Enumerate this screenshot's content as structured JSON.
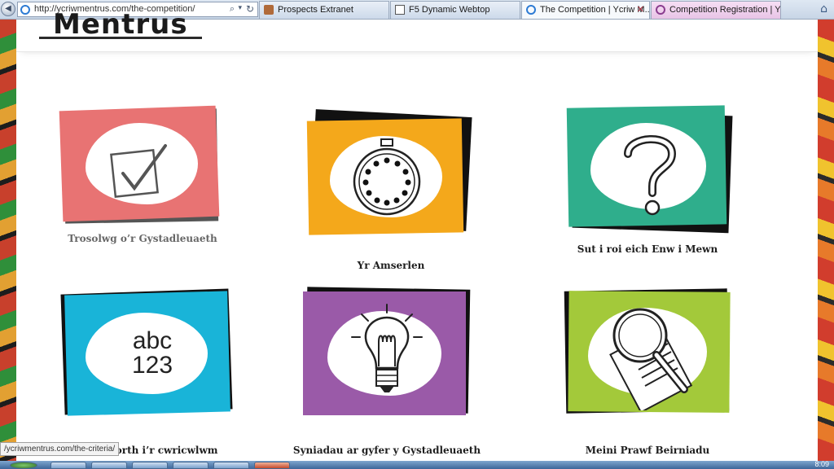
{
  "browser": {
    "address_url": "http://ycriwmentrus.com/the-competition/",
    "tabs": [
      {
        "title": "Prospects Extranet",
        "state": "inactive"
      },
      {
        "title": "F5 Dynamic Webtop",
        "state": "inactive"
      },
      {
        "title": "The Competition | Ycriw M...",
        "state": "active"
      },
      {
        "title": "Competition Registration | Ycri...",
        "state": "inactive"
      }
    ],
    "status_url": "/ycriwmentrus.com/the-criteria/"
  },
  "site": {
    "logo_text": "Mentrus"
  },
  "cards": [
    {
      "label": "Trosolwg o’r Gystadleuaeth",
      "color": "#e87373",
      "icon": "checkbox-icon"
    },
    {
      "label": "Yr Amserlen",
      "color": "#f4a81b",
      "icon": "stopwatch-icon"
    },
    {
      "label": "Sut i roi eich Enw i Mewn",
      "color": "#2fae8c",
      "icon": "question-mark-icon"
    },
    {
      "label": "Cymorth i’r cwricwlwm",
      "color": "#19b4d8",
      "icon": "abc-123-icon",
      "icon_text_top": "abc",
      "icon_text_bottom": "123"
    },
    {
      "label": "Syniadau ar gyfer y Gystadleuaeth",
      "color": "#9a5aa8",
      "icon": "lightbulb-icon"
    },
    {
      "label": "Meini Prawf Beirniadu",
      "color": "#a3c93a",
      "icon": "magnifying-glass-icon"
    }
  ],
  "taskbar": {
    "clock": "8:09"
  }
}
